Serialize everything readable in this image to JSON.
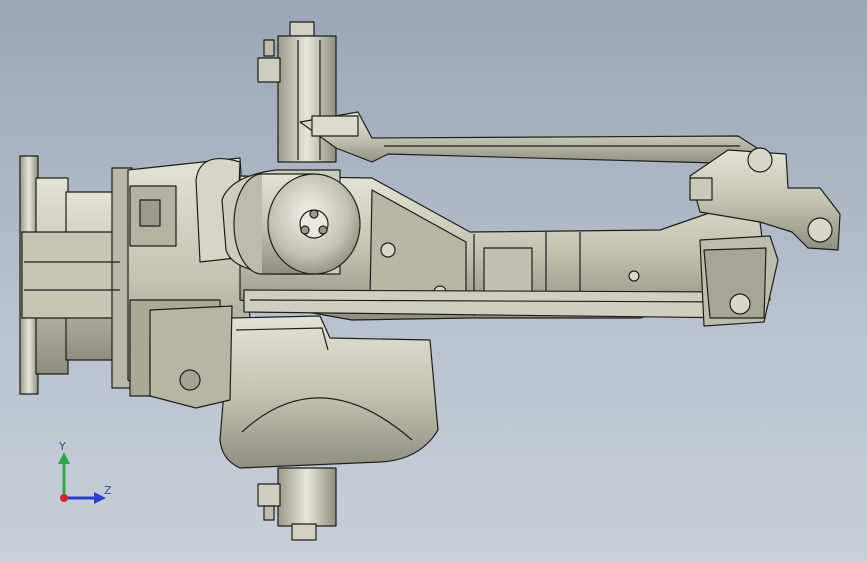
{
  "viewport": {
    "background_top": "#9aa6b6",
    "background_bottom": "#c8cfd8"
  },
  "model": {
    "body_color": "#c9c9b8",
    "shade_color": "#a7a797",
    "edge_color": "#1e1e1e"
  },
  "triad": {
    "y_label": "Y",
    "z_label": "Z",
    "y_color": "#2ea84a",
    "z_color": "#2b3fd0",
    "x_color": "#d2262a"
  }
}
